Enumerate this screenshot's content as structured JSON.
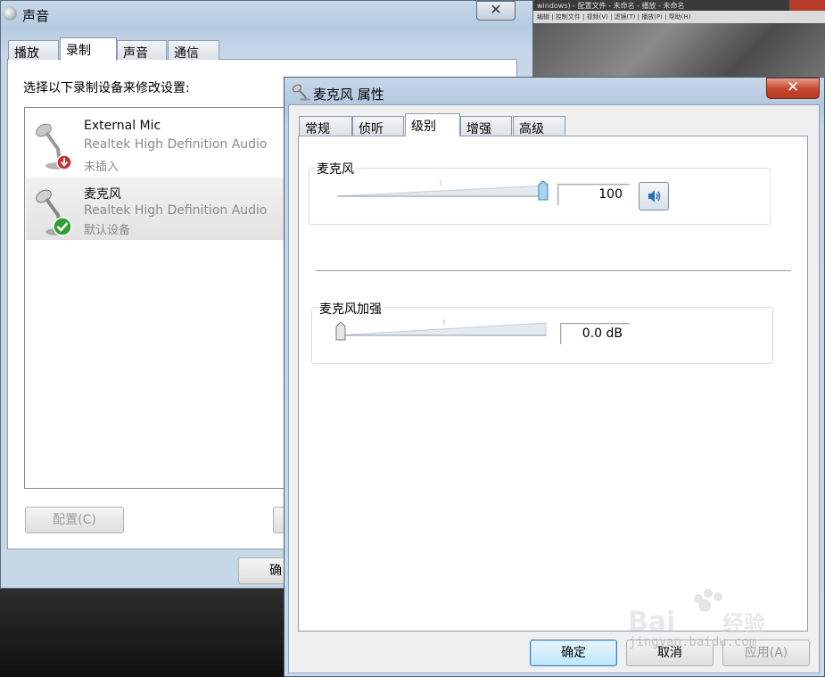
{
  "background_app": {
    "title": "windows) - 配置文件 - 未命名 - 播放 - 未命名",
    "menu": "编辑 | 控制文件 | 视频(V) | 滤镜(T) | 播放(P) | 帮助(H)"
  },
  "sound_window": {
    "title": "声音",
    "tabs": [
      "播放",
      "录制",
      "声音",
      "通信"
    ],
    "active_tab": 1,
    "instruction": "选择以下录制设备来修改设置:",
    "devices": [
      {
        "name": "External Mic",
        "driver": "Realtek High Definition Audio",
        "status": "未插入",
        "badge": "unplugged",
        "selected": false
      },
      {
        "name": "麦克风",
        "driver": "Realtek High Definition Audio",
        "status": "默认设备",
        "badge": "default",
        "selected": true
      }
    ],
    "configure_button": "配置(C)",
    "ok_button_partial": "确"
  },
  "properties_dialog": {
    "title": "麦克风 属性",
    "tabs": [
      "常规",
      "侦听",
      "级别",
      "增强",
      "高级"
    ],
    "active_tab": 2,
    "microphone_group": {
      "label": "麦克风",
      "slider_level": 1.0,
      "value": "100",
      "mute_icon": "speaker-icon"
    },
    "boost_group": {
      "label": "麦克风加强",
      "slider_level": 0.0,
      "value": "0.0 dB"
    },
    "buttons": {
      "ok": "确定",
      "cancel": "取消",
      "apply": "应用(A)"
    }
  },
  "watermark": {
    "text": "Baidu经验",
    "url": "jingyan.baidu.com"
  },
  "colors": {
    "title_bar": "#b6cbe1",
    "close_button": "#c74a32",
    "default_button": "#bee6fd",
    "slider_thumb": "#a9d2ef",
    "default_check": "#2f9e2f",
    "unplugged_badge": "#cc2a2a"
  }
}
